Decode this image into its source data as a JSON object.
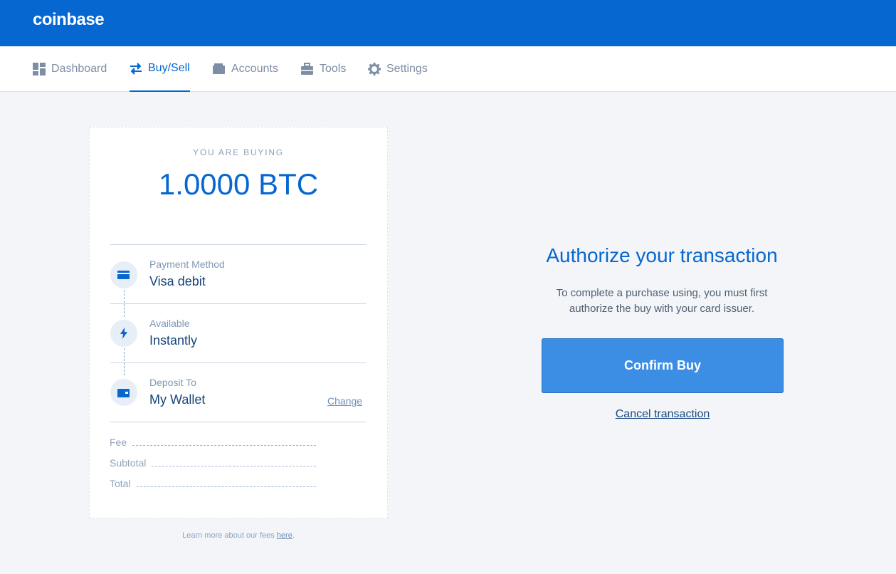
{
  "header": {
    "logo": "coinbase"
  },
  "nav": {
    "items": [
      {
        "label": "Dashboard",
        "icon": "dashboard-icon"
      },
      {
        "label": "Buy/Sell",
        "icon": "transfer-arrows-icon",
        "active": true
      },
      {
        "label": "Accounts",
        "icon": "wallet-icon"
      },
      {
        "label": "Tools",
        "icon": "toolbox-icon"
      },
      {
        "label": "Settings",
        "icon": "gear-icon"
      }
    ]
  },
  "order": {
    "heading": "YOU ARE BUYING",
    "amount": "1.0000 BTC",
    "payment": {
      "label": "Payment Method",
      "value": "Visa debit",
      "icon": "card-icon"
    },
    "available": {
      "label": "Available",
      "value": "Instantly",
      "icon": "lightning-icon"
    },
    "deposit": {
      "label": "Deposit To",
      "value": "My Wallet",
      "icon": "wallet-icon",
      "change": "Change"
    },
    "fees": {
      "fee": "Fee",
      "subtotal": "Subtotal",
      "total": "Total"
    },
    "note_prefix": "Learn more about our fees ",
    "note_link": "here",
    "note_suffix": "."
  },
  "authorize": {
    "title": "Authorize your transaction",
    "text": "To complete a purchase using, you must first authorize the buy with your card issuer.",
    "confirm": "Confirm Buy",
    "cancel": "Cancel transaction"
  },
  "colors": {
    "brand": "#0667d0",
    "button": "#3b8ee4",
    "background": "#f3f5f8"
  }
}
